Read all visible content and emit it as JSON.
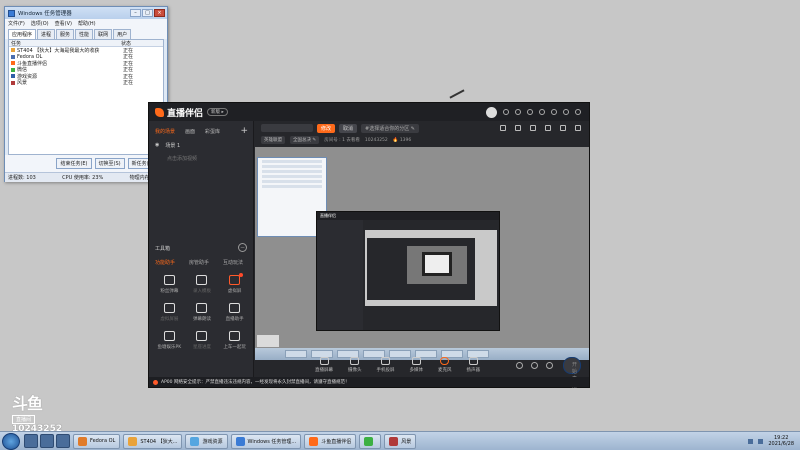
{
  "task_manager": {
    "title": "Windows 任务管理器",
    "menu": [
      "文件(F)",
      "选项(O)",
      "查看(V)",
      "帮助(H)"
    ],
    "tabs": [
      "应用程序",
      "进程",
      "服务",
      "性能",
      "联网",
      "用户"
    ],
    "columns": [
      "任务",
      "状态"
    ],
    "rows": [
      {
        "name": "ST404",
        "tail": "【狄大】大海是我最大的收获",
        "status": "正在",
        "color": "#e9a33b"
      },
      {
        "name": "Fedora OL",
        "tail": "",
        "status": "正在",
        "color": "#4a6fb0"
      },
      {
        "name": "斗鱼直播伴侣",
        "tail": "",
        "status": "正在",
        "color": "#ff6a1a"
      },
      {
        "name": "微信",
        "tail": "",
        "status": "正在",
        "color": "#3cb043"
      },
      {
        "name": "游戏资源",
        "tail": "",
        "status": "正在",
        "color": "#2f5fa8"
      },
      {
        "name": "风景",
        "tail": "",
        "status": "正在",
        "color": "#b03a3a"
      }
    ],
    "buttons": [
      "结束任务(E)",
      "切换至(S)",
      "新任务(N)..."
    ],
    "status": {
      "processes": "进程数: 103",
      "cpu": "CPU 使用率: 23%",
      "memory": "物理内存: 62%"
    }
  },
  "douyu": {
    "logo_text": "直播伴侣",
    "version": "新版 ▸",
    "sidebar": {
      "tabs": [
        "我的场景",
        "画面",
        "彩蛋库"
      ],
      "scene_label": "场景 1",
      "add_source_hint": "点击添加视频",
      "toolbox_title": "工具箱",
      "categories": [
        "功能助手",
        "房管助手",
        "互动玩法"
      ],
      "tools": [
        {
          "label": "粉丝弹幕",
          "dim": false,
          "highlight": false,
          "badge": false
        },
        {
          "label": "录入模板",
          "dim": true,
          "highlight": false,
          "badge": false
        },
        {
          "label": "虚拟屏",
          "dim": false,
          "highlight": true,
          "badge": true
        },
        {
          "label": "虚拟屏展",
          "dim": true,
          "highlight": false,
          "badge": false
        },
        {
          "label": "弹幕朗读",
          "dim": false,
          "highlight": false,
          "badge": false
        },
        {
          "label": "直播助手",
          "dim": false,
          "highlight": false,
          "badge": false
        },
        {
          "label": "鱼塘娱乐PK",
          "dim": false,
          "highlight": false,
          "badge": false
        },
        {
          "label": "星座进度",
          "dim": true,
          "highlight": false,
          "badge": false
        },
        {
          "label": "上车一起玩",
          "dim": false,
          "highlight": false,
          "badge": false
        }
      ]
    },
    "topbar": {
      "edit_btn": "修改",
      "cancel_btn": "取消",
      "placeholder": "#选择适合你的分区 ✎"
    },
    "infobar": {
      "category": "英雄联盟",
      "subcategory": "全国总决 ✎",
      "room_label": "房间号 : 1 去看看",
      "room_id": "10243252",
      "heat": "🔥 1396"
    },
    "bottom_bar": [
      "直播屏幕",
      "摄像头",
      "手机投屏",
      "多媒体",
      "麦克风",
      "扬声器"
    ],
    "start_label": "开始直播",
    "notice": "AP00 网络安全提示：严禁直播违法违规内容，一经发现将永久封禁直播间，请遵守直播规范！"
  },
  "watermark": {
    "brand": "斗鱼",
    "room_tag": "直播间",
    "room_number": "10243252"
  },
  "taskbar": {
    "tasks": [
      {
        "label": "Fedora OL",
        "color": "#e07b2a"
      },
      {
        "label": "ST404 【狄大...",
        "color": "#e9a33b"
      },
      {
        "label": "游戏资源",
        "color": "#55a6e0"
      },
      {
        "label": "Windows 任务管理...",
        "color": "#3a7bd5"
      },
      {
        "label": "斗鱼直播伴侣",
        "color": "#ff6a1a"
      },
      {
        "label": "",
        "color": "#3cb043"
      },
      {
        "label": "风景",
        "color": "#b03a3a"
      }
    ],
    "clock_time": "19:22",
    "clock_date": "2021/6/28"
  }
}
